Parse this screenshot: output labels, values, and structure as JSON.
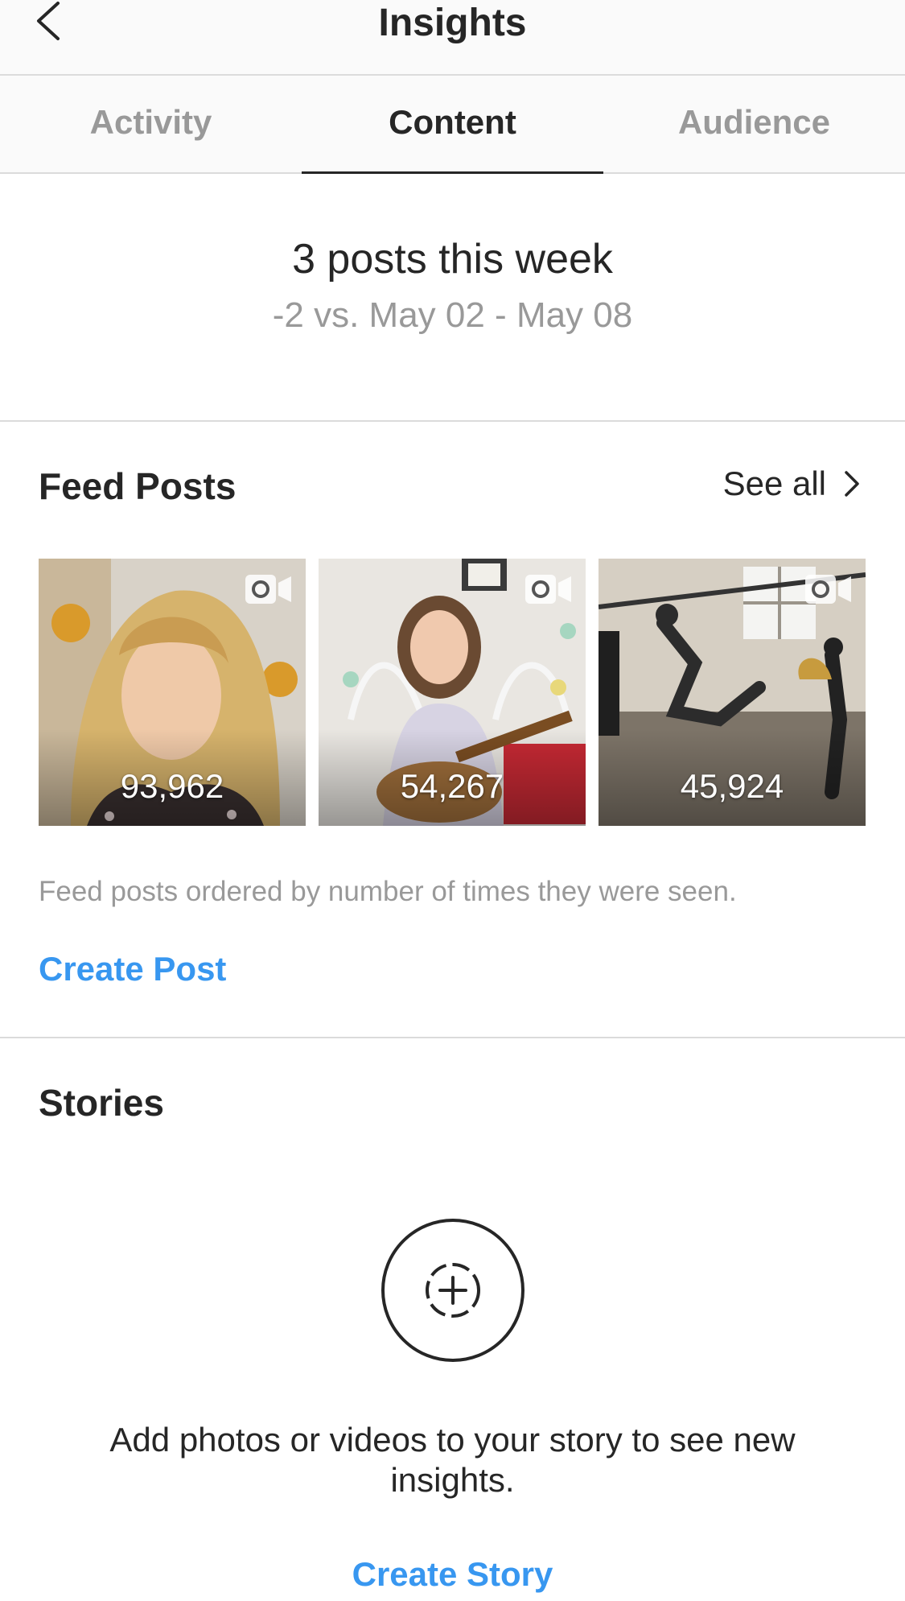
{
  "header": {
    "title": "Insights"
  },
  "tabs": [
    {
      "label": "Activity",
      "active": false
    },
    {
      "label": "Content",
      "active": true
    },
    {
      "label": "Audience",
      "active": false
    }
  ],
  "summary": {
    "main": "3 posts this week",
    "sub": "-2 vs. May 02 - May 08"
  },
  "feed": {
    "title": "Feed Posts",
    "see_all_label": "See all",
    "posts": [
      {
        "count": "93,962",
        "type": "video"
      },
      {
        "count": "54,267",
        "type": "video"
      },
      {
        "count": "45,924",
        "type": "video"
      }
    ],
    "note": "Feed posts ordered by number of times they were seen.",
    "create_label": "Create Post"
  },
  "stories": {
    "title": "Stories",
    "message": "Add photos or videos to your story to see new insights.",
    "create_label": "Create Story"
  },
  "colors": {
    "accent": "#3897f0",
    "text": "#262626",
    "muted": "#999999",
    "divider": "#dbdbdb"
  },
  "icons": {
    "back": "chevron-left-icon",
    "see_all": "chevron-right-icon",
    "video": "video-camera-icon",
    "add_story": "add-story-icon"
  }
}
